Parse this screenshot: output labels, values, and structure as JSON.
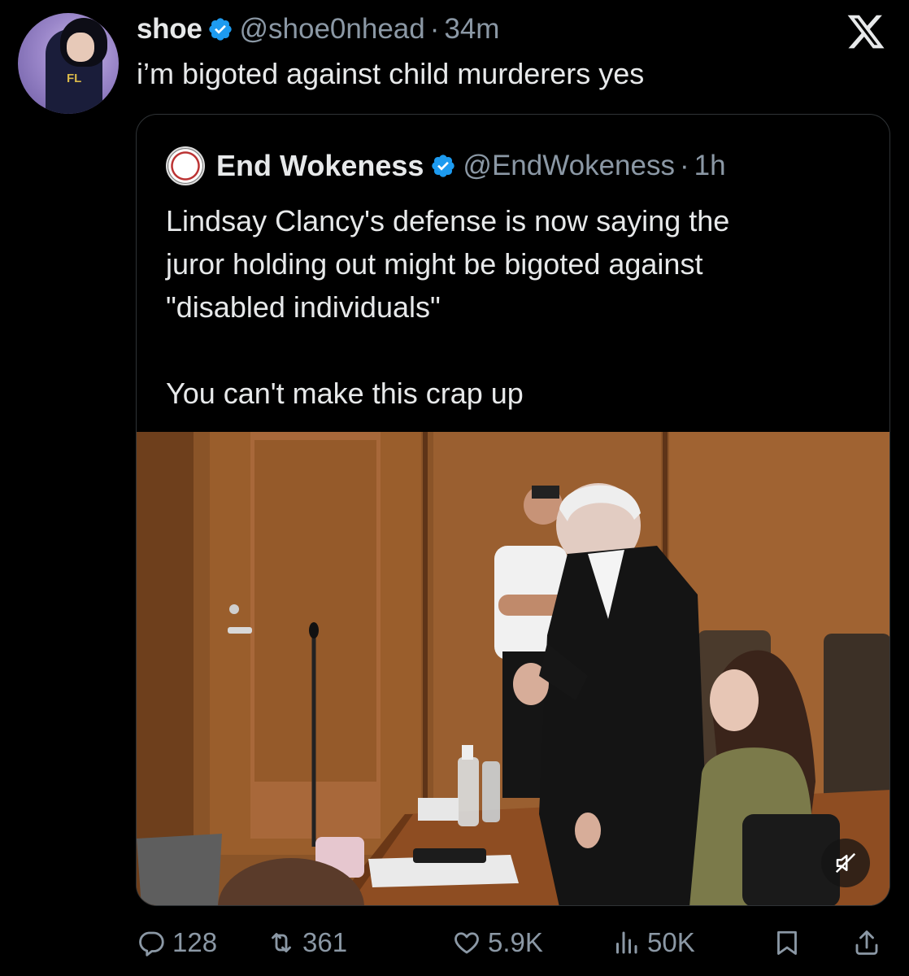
{
  "tweet": {
    "author_name": "shoe",
    "author_handle": "@shoe0nhead",
    "separator": "·",
    "time": "34m",
    "text": "i’m bigoted against child murderers yes",
    "avatar_badge": "FL"
  },
  "quoted": {
    "author_name": "End Wokeness",
    "author_handle": "@EndWokeness",
    "separator": "·",
    "time": "1h",
    "text_lines": [
      "Lindsay Clancy's defense is now saying the",
      "juror holding out might be bigoted against",
      "\"disabled individuals\"",
      "You can't make this crap up"
    ],
    "media": {
      "kind": "video",
      "muted": true,
      "mute_icon": "speaker-muted-icon"
    }
  },
  "actions": {
    "reply_count": "128",
    "repost_count": "361",
    "like_count": "5.9K",
    "views_count": "50K"
  },
  "colors": {
    "background": "#000000",
    "text_primary": "#e7e9ea",
    "text_secondary": "#8b98a5",
    "verified_blue": "#1d9bf0",
    "border": "#2f3336"
  }
}
